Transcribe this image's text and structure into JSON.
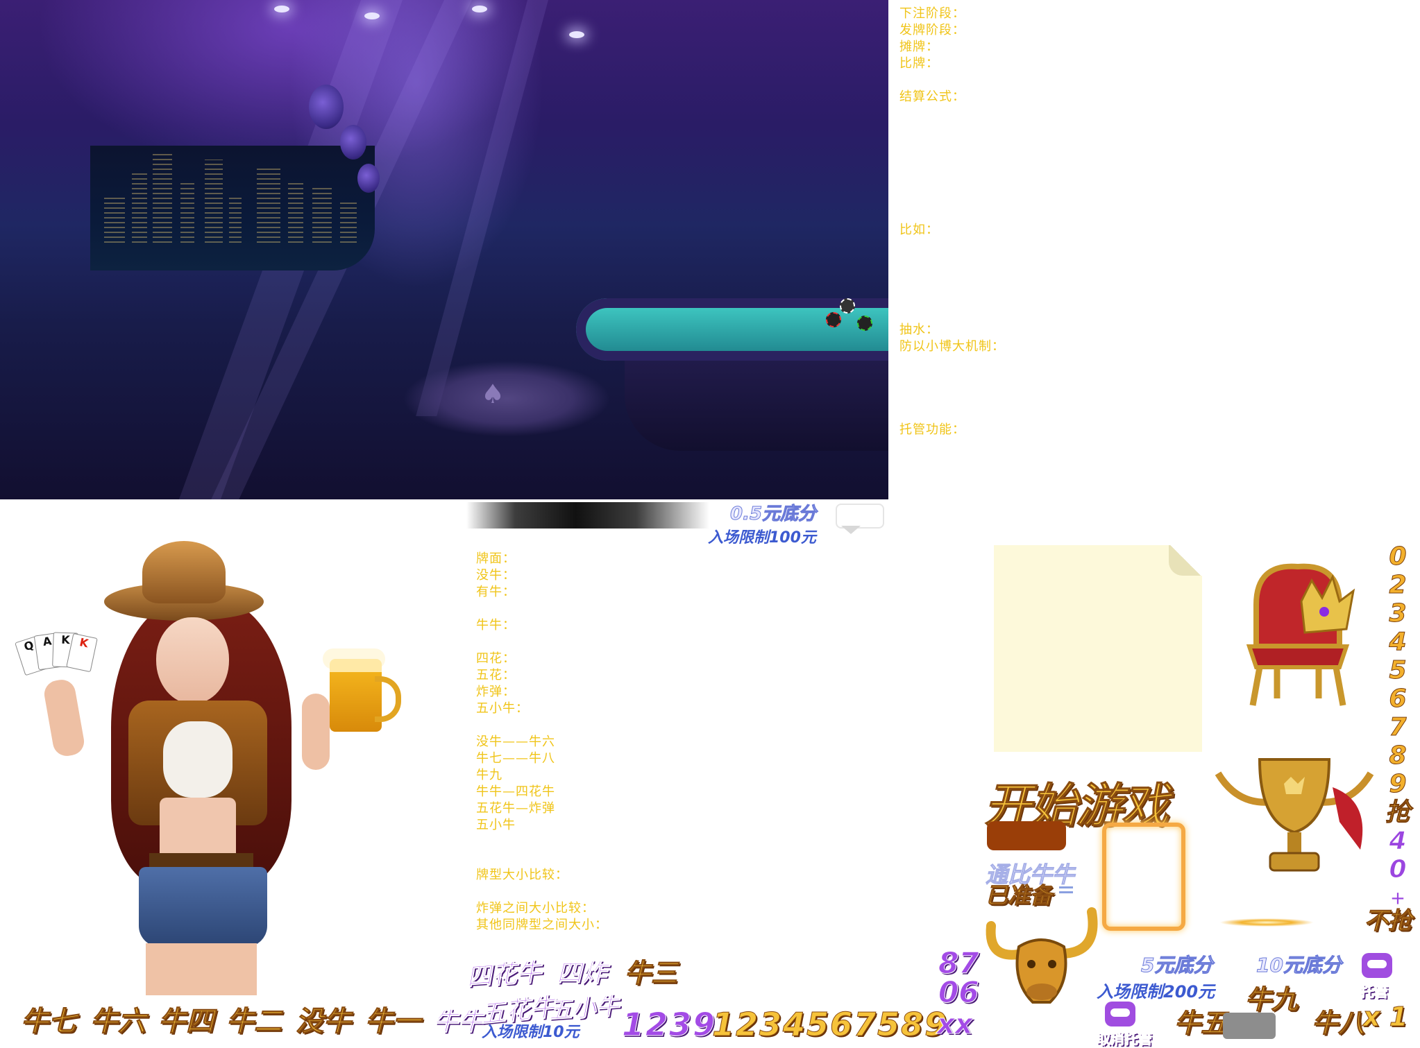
{
  "rules_top": {
    "bet_phase": "下注阶段：",
    "deal_phase": "发牌阶段：",
    "show_cards": "摊牌：",
    "compare": "比牌：",
    "settle_formula": "结算公式：",
    "example": "比如：",
    "rake": "抽水：",
    "anti_small_big": "防以小博大机制：",
    "auto_play": "托管功能："
  },
  "rules_cards": {
    "lines": [
      "牌面：",
      "没牛：",
      "有牛：",
      "",
      "牛牛：",
      "",
      "四花：",
      "五花：",
      "炸弹：",
      "五小牛：",
      "",
      "没牛——牛六",
      "牛七——牛八",
      "牛九",
      "牛牛—四花牛",
      "五花牛—炸弹",
      "五小牛",
      "",
      "",
      "牌型大小比较：",
      "",
      "炸弹之间大小比较：",
      "其他同牌型之间大小："
    ]
  },
  "rooms": {
    "base_05": "0.5元底分",
    "limit_100": "入场限制100元",
    "base_5": "5元底分",
    "limit_200": "入场限制200元",
    "base_10": "10元底分",
    "limit_10": "入场限制10元"
  },
  "buttons": {
    "start_game": "开始游戏",
    "ready": "已准备",
    "pass_cow": "通比牛牛",
    "auto": "托管",
    "cancel_auto": "取消托管",
    "no_grab": "不抢",
    "grab": "抢"
  },
  "hands": {
    "niu7": "牛七",
    "niu6": "牛六",
    "niu4": "牛四",
    "niu2": "牛二",
    "meiniu": "没牛",
    "niu1": "牛一",
    "niuniu": "牛牛",
    "wuhua": "五花牛",
    "wuxiao": "五小牛",
    "sihua": "四花牛",
    "sizha": "四炸",
    "niu3": "牛三",
    "niu9": "牛九",
    "niu5": "牛五",
    "niu8": "牛八"
  },
  "numbers": {
    "purple_seq": "1239",
    "gold_seq": "1234567589",
    "xx": "xx",
    "n87": "87",
    "n06": "06",
    "x1": "x 1",
    "side_digits": [
      "0",
      "2",
      "3",
      "4",
      "5",
      "6",
      "7",
      "8",
      "9",
      "抢",
      "4",
      "0",
      "+"
    ]
  },
  "cards": [
    "Q",
    "A",
    "K",
    "K"
  ],
  "colors": {
    "rule_text": "#f0c418",
    "gold": "#f6c33a",
    "purple": "#a34be6"
  }
}
